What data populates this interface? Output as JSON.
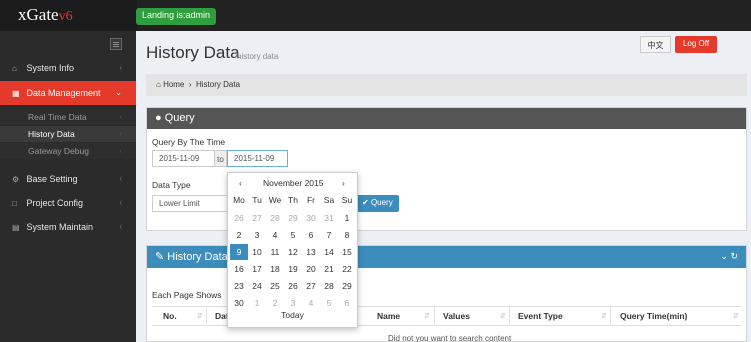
{
  "app": {
    "logo": "xGate",
    "version": "v6",
    "login_status": "Landing is:admin"
  },
  "sidebar": {
    "items": [
      {
        "label": "System Info",
        "icon": "home-icon"
      },
      {
        "label": "Data Management",
        "icon": "table-icon",
        "active": true
      },
      {
        "label": "Base Setting",
        "icon": "gears-icon"
      },
      {
        "label": "Project Config",
        "icon": "bookmark-icon"
      },
      {
        "label": "System Maintain",
        "icon": "server-icon"
      }
    ],
    "subitems": [
      {
        "label": "Real Time Data"
      },
      {
        "label": "History Data",
        "active": true
      },
      {
        "label": "Gateway Debug"
      }
    ]
  },
  "header": {
    "title": "History Data",
    "subtitle": "history data",
    "lang_button": "中文",
    "logoff_button": "Log Off"
  },
  "breadcrumb": {
    "home": "Home",
    "current": "History Data"
  },
  "query": {
    "title": "Query",
    "by_time_label": "Query By The Time",
    "from_date": "2015-11-09",
    "to_label": "to",
    "to_date": "2015-11-09",
    "data_type_label": "Data Type",
    "data_type_value": "Lower Limit",
    "query_button": "Query"
  },
  "history": {
    "title": "History Data",
    "page_shows_label": "Each Page Shows",
    "columns": [
      "No.",
      "Dat",
      "Name",
      "Values",
      "Event Type",
      "Query Time(min)"
    ],
    "empty_text": "Did not you want to search content"
  },
  "datepicker": {
    "month_label": "November 2015",
    "prev": "‹",
    "next": "›",
    "weekdays": [
      "Mo",
      "Tu",
      "We",
      "Th",
      "Fr",
      "Sa",
      "Su"
    ],
    "weeks": [
      [
        "26",
        "27",
        "28",
        "29",
        "30",
        "31",
        "1"
      ],
      [
        "2",
        "3",
        "4",
        "5",
        "6",
        "7",
        "8"
      ],
      [
        "9",
        "10",
        "11",
        "12",
        "13",
        "14",
        "15"
      ],
      [
        "16",
        "17",
        "18",
        "19",
        "20",
        "21",
        "22"
      ],
      [
        "23",
        "24",
        "25",
        "26",
        "27",
        "28",
        "29"
      ],
      [
        "30",
        "1",
        "2",
        "3",
        "4",
        "5",
        "6"
      ]
    ],
    "selected": "9",
    "today_label": "Today"
  },
  "colors": {
    "accent": "#3c8dbc",
    "brand_red": "#e33a2c",
    "login_green": "#2e9e3e"
  }
}
